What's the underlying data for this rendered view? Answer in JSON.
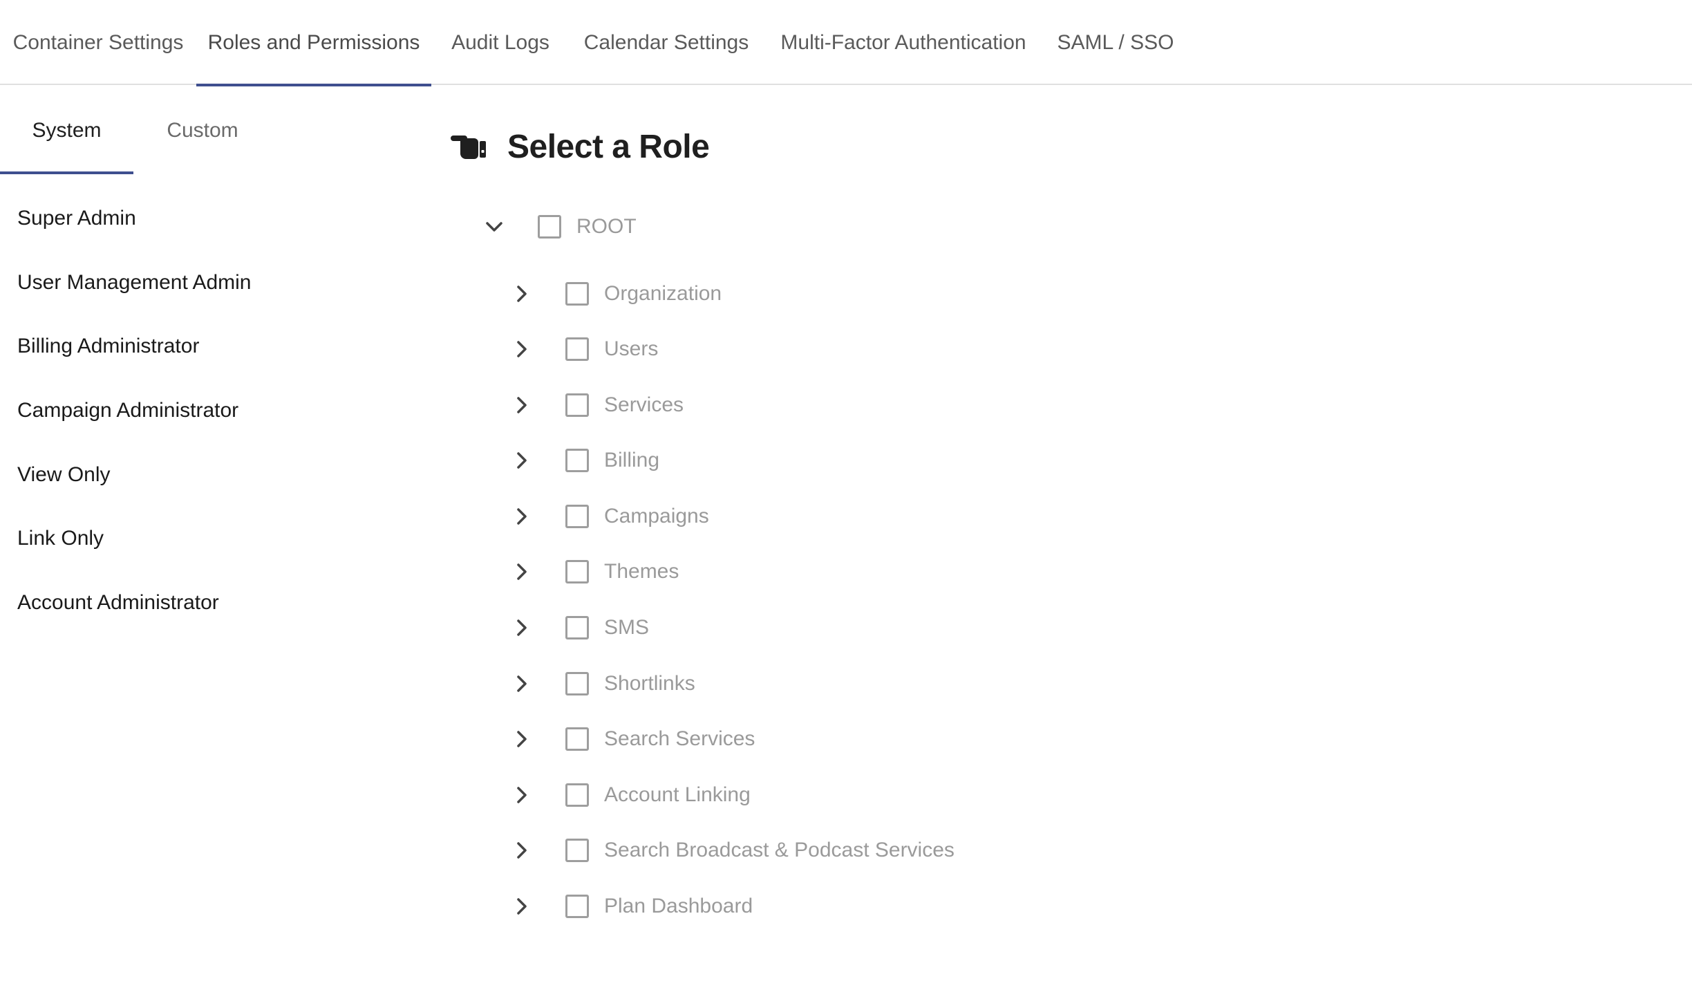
{
  "top_tabs": [
    {
      "label": "Container Settings",
      "active": false
    },
    {
      "label": "Roles and Permissions",
      "active": true
    },
    {
      "label": "Audit Logs",
      "active": false
    },
    {
      "label": "Calendar Settings",
      "active": false
    },
    {
      "label": "Multi-Factor Authentication",
      "active": false
    },
    {
      "label": "SAML / SSO",
      "active": false
    }
  ],
  "sub_tabs": [
    {
      "label": "System",
      "active": true
    },
    {
      "label": "Custom",
      "active": false
    }
  ],
  "roles": [
    "Super Admin",
    "User Management Admin",
    "Billing Administrator",
    "Campaign Administrator",
    "View Only",
    "Link Only",
    "Account Administrator"
  ],
  "main": {
    "title": "Select a Role",
    "title_icon": "pointing-hand-icon"
  },
  "tree": {
    "root": {
      "label": "ROOT",
      "expanded": true,
      "checked": false
    },
    "children": [
      {
        "label": "Organization",
        "checked": false
      },
      {
        "label": "Users",
        "checked": false
      },
      {
        "label": "Services",
        "checked": false
      },
      {
        "label": "Billing",
        "checked": false
      },
      {
        "label": "Campaigns",
        "checked": false
      },
      {
        "label": "Themes",
        "checked": false
      },
      {
        "label": "SMS",
        "checked": false
      },
      {
        "label": "Shortlinks",
        "checked": false
      },
      {
        "label": "Search Services",
        "checked": false
      },
      {
        "label": "Account Linking",
        "checked": false
      },
      {
        "label": "Search Broadcast & Podcast Services",
        "checked": false
      },
      {
        "label": "Plan Dashboard",
        "checked": false
      }
    ]
  },
  "colors": {
    "accent": "#3f4f8f",
    "muted_text": "#9a9a9a",
    "checkbox_border": "#9e9e9e"
  }
}
